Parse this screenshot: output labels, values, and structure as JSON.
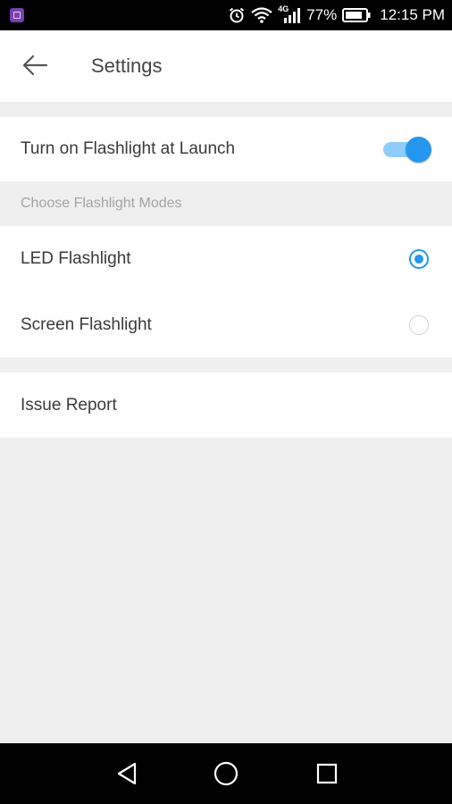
{
  "status_bar": {
    "network": "4G",
    "battery": "77%",
    "time": "12:15 PM"
  },
  "header": {
    "title": "Settings"
  },
  "settings": {
    "launch_toggle": {
      "label": "Turn on Flashlight at Launch",
      "on": true
    },
    "modes_section": {
      "label": "Choose Flashlight Modes",
      "options": [
        {
          "label": "LED Flashlight",
          "selected": true
        },
        {
          "label": "Screen Flashlight",
          "selected": false
        }
      ]
    },
    "issue_report": {
      "label": "Issue Report"
    }
  },
  "colors": {
    "accent": "#2496f0",
    "accent_light": "#8fcdf8",
    "background": "#efefef"
  },
  "icons": {
    "status_left": "app-notification-icon",
    "status_right": [
      "alarm-icon",
      "wifi-icon",
      "signal-icon",
      "battery-icon"
    ],
    "nav": [
      "back-triangle-icon",
      "home-circle-icon",
      "recents-square-icon"
    ]
  }
}
